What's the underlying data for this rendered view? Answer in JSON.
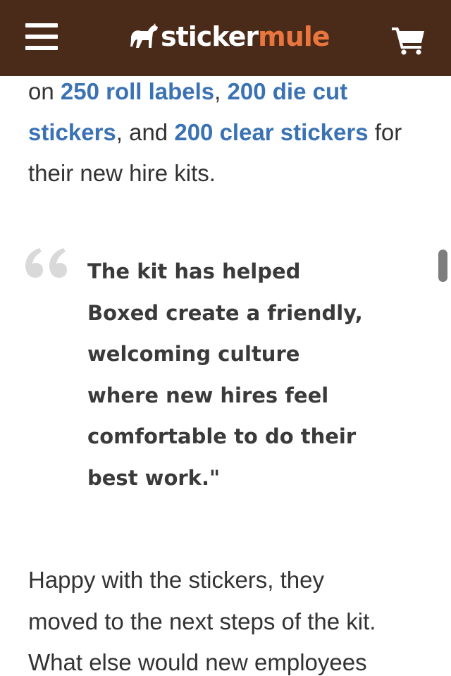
{
  "header": {
    "menu_icon": "hamburger-menu-icon",
    "logo": {
      "icon": "mule-icon",
      "sticker": "sticker",
      "mule": "mule"
    },
    "cart_icon": "shopping-cart-icon",
    "colors": {
      "header_bg": "#4a2a19",
      "logo_accent": "#e9763e",
      "link": "#3a72b4"
    }
  },
  "article": {
    "intro": {
      "t1": "on ",
      "link1": "250 roll labels",
      "t2": ", ",
      "link2": "200 die cut stickers",
      "t3": ", and ",
      "link3": "200 clear stickers",
      "t4": " for their new hire kits."
    },
    "quote": {
      "icon": "quote-icon",
      "lines": [
        "The kit has helped",
        "Boxed create a friendly,",
        "welcoming culture",
        "where new hires feel",
        "comfortable to do their",
        "best work.\""
      ]
    },
    "followup": {
      "lines": [
        "Happy with the stickers, they",
        "moved to the next steps of the kit.",
        "What else would new employees"
      ]
    }
  }
}
